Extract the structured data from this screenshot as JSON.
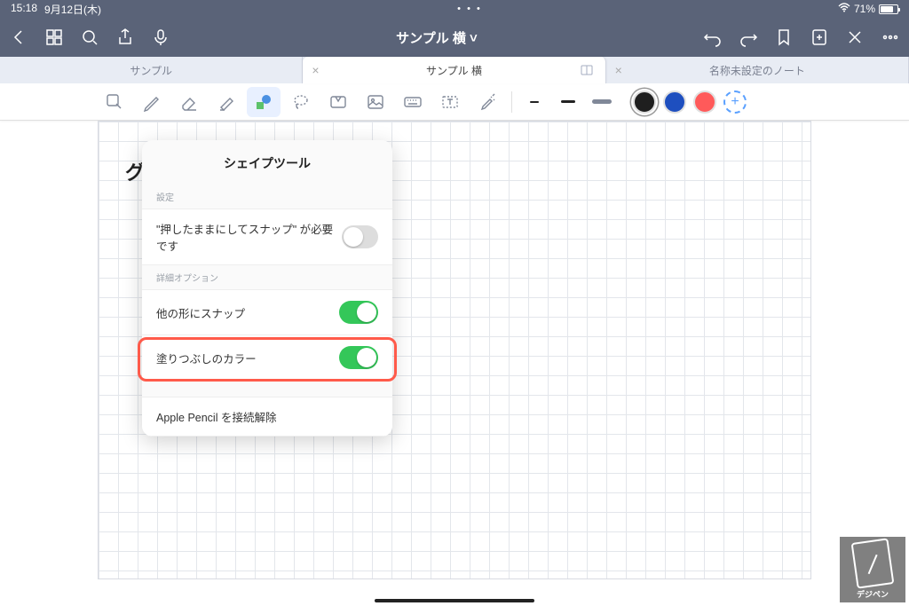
{
  "status": {
    "time": "15:18",
    "date": "9月12日(木)",
    "battery": "71%"
  },
  "nav": {
    "title": "サンプル 横 ˅"
  },
  "tabs": [
    {
      "label": "サンプル",
      "active": false
    },
    {
      "label": "サンプル 横",
      "active": true
    },
    {
      "label": "名称未設定のノート",
      "active": false
    }
  ],
  "strokes": {
    "s1": 10,
    "s2": 16,
    "s3": 22
  },
  "canvas": {
    "text": "グ"
  },
  "popover": {
    "title": "シェイプツール",
    "section1": "設定",
    "row1": "\"押したままにしてスナップ\" が必要です",
    "section2": "詳細オプション",
    "row2": "他の形にスナップ",
    "row3": "塗りつぶしのカラー",
    "row4": "Apple Pencil を接続解除"
  },
  "watermark": {
    "label": "デジペン"
  },
  "colors": {
    "black": "#1f1f1f",
    "blue": "#1e4fbf",
    "red": "#ff5a5a"
  }
}
